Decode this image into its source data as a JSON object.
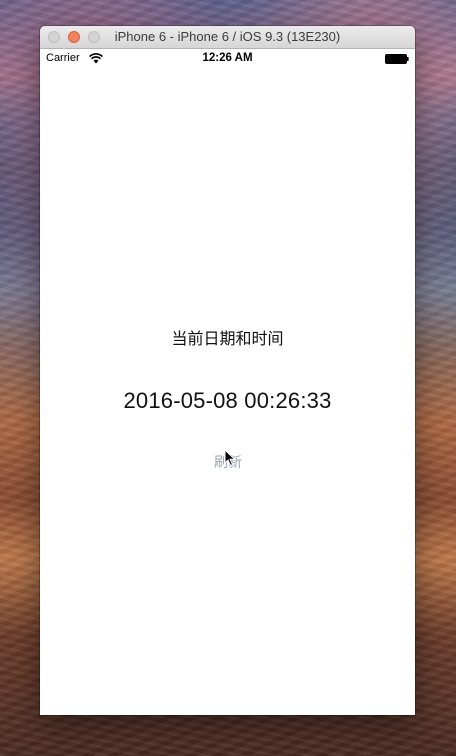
{
  "window": {
    "title": "iPhone 6 - iPhone 6 / iOS 9.3 (13E230)"
  },
  "status_bar": {
    "carrier": "Carrier",
    "time": "12:26 AM"
  },
  "app": {
    "label": "当前日期和时间",
    "datetime": "2016-05-08 00:26:33",
    "refresh_label": "刷新"
  },
  "icons": [
    "close-icon",
    "minimize-icon",
    "zoom-icon",
    "wifi-icon",
    "battery-icon",
    "cursor-icon"
  ],
  "colors": {
    "link_button": "#9aa6b4",
    "minimize_button": "#f0845f"
  }
}
